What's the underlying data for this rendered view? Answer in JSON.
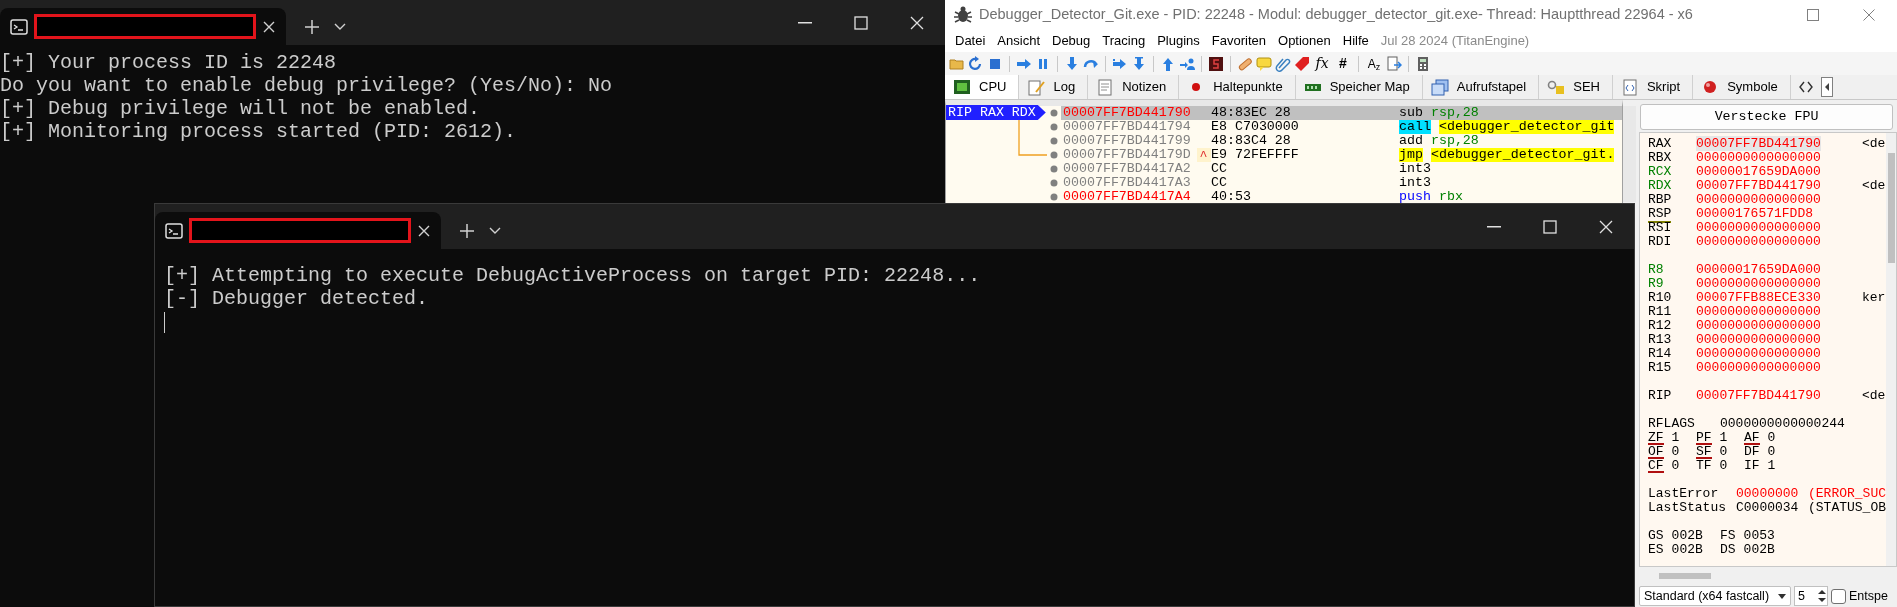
{
  "back_terminal": {
    "lines": [
      "[+] Your process ID is 22248",
      "Do you want to enable debug privilege? (Yes/No): No",
      "[+] Debug privilege will not be enabled.",
      "[+] Monitoring process started (PID: 2612)."
    ]
  },
  "debugger": {
    "title": "Debugger_Detector_Git.exe - PID: 22248 - Modul: debugger_detector_git.exe- Thread: Hauptthread 22964 - x6",
    "menu": [
      "Datei",
      "Ansicht",
      "Debug",
      "Tracing",
      "Plugins",
      "Favoriten",
      "Optionen",
      "Hilfe"
    ],
    "build_info": "Jul 28 2024 (TitanEngine)",
    "toolbar_glyphs": [
      "fx",
      "#",
      "A$_{z}$"
    ],
    "tabs": [
      {
        "label": "CPU",
        "selected": true
      },
      {
        "label": "Log",
        "selected": false
      },
      {
        "label": "Notizen",
        "selected": false
      },
      {
        "label": "Haltepunkte",
        "selected": false
      },
      {
        "label": "Speicher Map",
        "selected": false
      },
      {
        "label": "Aufrufstapel",
        "selected": false
      },
      {
        "label": "SEH",
        "selected": false
      },
      {
        "label": "Skript",
        "selected": false
      },
      {
        "label": "Symbole",
        "selected": false
      }
    ],
    "disassembly": {
      "rip_label": "RIP RAX RDX",
      "rows": [
        {
          "address": "00007FF7BD441790",
          "color": "#ff0000",
          "bytes": "48:83EC 28",
          "kind": "plain",
          "mnemonic": "sub",
          "operands": "rsp,28",
          "selected": true
        },
        {
          "address": "00007FF7BD441794",
          "color": "#808080",
          "bytes": "E8 C7030000",
          "kind": "call",
          "mnemonic": "call",
          "operands": "<debugger_detector_git",
          "selected": false
        },
        {
          "address": "00007FF7BD441799",
          "color": "#808080",
          "bytes": "48:83C4 28",
          "kind": "plain",
          "mnemonic": "add",
          "operands": "rsp,28",
          "selected": false
        },
        {
          "address": "00007FF7BD44179D",
          "color": "#808080",
          "bytes": "E9 72FEFFFF",
          "marker": "^",
          "kind": "jmp",
          "mnemonic": "jmp",
          "operands": "<debugger_detector_git.",
          "selected": false
        },
        {
          "address": "00007FF7BD4417A2",
          "color": "#808080",
          "bytes": "CC",
          "kind": "plain",
          "mnemonic": "int3",
          "selected": false
        },
        {
          "address": "00007FF7BD4417A3",
          "color": "#808080",
          "bytes": "CC",
          "kind": "plain",
          "mnemonic": "int3",
          "selected": false
        },
        {
          "address": "00007FF7BD4417A4",
          "color": "#ff0000",
          "bytes": "40:53",
          "kind": "push",
          "mnemonic": "push",
          "operands": "rbx",
          "selected": false
        }
      ]
    },
    "registers": {
      "fpu_button": "Verstecke FPU",
      "groups": [
        [
          {
            "name": "RAX",
            "color": "#000000",
            "value": "00007FF7BD441790",
            "changed": true,
            "selected": true,
            "underlined": false,
            "comment": "<de"
          },
          {
            "name": "RBX",
            "color": "#000000",
            "value": "0000000000000000",
            "changed": true,
            "selected": false,
            "underlined": false
          },
          {
            "name": "RCX",
            "color": "#008000",
            "value": "00000017659DA000",
            "changed": true,
            "selected": false,
            "underlined": false
          },
          {
            "name": "RDX",
            "color": "#008000",
            "value": "00007FF7BD441790",
            "changed": true,
            "selected": false,
            "underlined": false,
            "comment": "<de"
          },
          {
            "name": "RBP",
            "color": "#000000",
            "value": "0000000000000000",
            "changed": true,
            "selected": false,
            "underlined": false
          },
          {
            "name": "RSP",
            "color": "#000000",
            "value": "00000176571FDD8",
            "changed": true,
            "selected": false,
            "underlined": true
          },
          {
            "name": "RSI",
            "color": "#000000",
            "value": "0000000000000000",
            "changed": true,
            "selected": false,
            "underlined": false
          },
          {
            "name": "RDI",
            "color": "#000000",
            "value": "0000000000000000",
            "changed": true,
            "selected": false,
            "underlined": false
          }
        ],
        [
          {
            "name": "R8",
            "color": "#008000",
            "value": "00000017659DA000",
            "changed": true,
            "selected": false,
            "underlined": false
          },
          {
            "name": "R9",
            "color": "#008000",
            "value": "0000000000000000",
            "changed": true,
            "selected": false,
            "underlined": false
          },
          {
            "name": "R10",
            "color": "#000000",
            "value": "00007FFB88ECE330",
            "changed": true,
            "selected": false,
            "underlined": false,
            "comment": "ker"
          },
          {
            "name": "R11",
            "color": "#000000",
            "value": "0000000000000000",
            "changed": true,
            "selected": false,
            "underlined": false
          },
          {
            "name": "R12",
            "color": "#000000",
            "value": "0000000000000000",
            "changed": true,
            "selected": false,
            "underlined": false
          },
          {
            "name": "R13",
            "color": "#000000",
            "value": "0000000000000000",
            "changed": true,
            "selected": false,
            "underlined": false
          },
          {
            "name": "R14",
            "color": "#000000",
            "value": "0000000000000000",
            "changed": true,
            "selected": false,
            "underlined": false
          },
          {
            "name": "R15",
            "color": "#000000",
            "value": "0000000000000000",
            "changed": true,
            "selected": false,
            "underlined": false
          }
        ],
        [
          {
            "name": "RIP",
            "color": "#000000",
            "value": "00007FF7BD441790",
            "changed": true,
            "selected": false,
            "underlined": false,
            "comment": "<de"
          }
        ]
      ],
      "rflags": {
        "name": "RFLAGS",
        "value": "0000000000000244"
      },
      "flags": [
        [
          {
            "name": "ZF",
            "value": "1",
            "underlined": true
          },
          {
            "name": "PF",
            "value": "1",
            "underlined": true
          },
          {
            "name": "AF",
            "value": "0",
            "underlined": true
          }
        ],
        [
          {
            "name": "OF",
            "value": "0",
            "underlined": true
          },
          {
            "name": "SF",
            "value": "0",
            "underlined": true
          },
          {
            "name": "DF",
            "value": "0",
            "underlined": false
          }
        ],
        [
          {
            "name": "CF",
            "value": "0",
            "underlined": true
          },
          {
            "name": "TF",
            "value": "0",
            "underlined": false
          },
          {
            "name": "IF",
            "value": "1",
            "underlined": false
          }
        ]
      ],
      "status": [
        {
          "label": "LastError",
          "value": "00000000",
          "text": "(ERROR_SUC",
          "changed": true
        },
        {
          "label": "LastStatus",
          "value": "C0000034",
          "text": "(STATUS_OB",
          "changed": false
        }
      ],
      "segments": [
        [
          {
            "name": "GS",
            "value": "002B"
          },
          {
            "name": "FS",
            "value": "0053"
          }
        ],
        [
          {
            "name": "ES",
            "value": "002B"
          },
          {
            "name": "DS",
            "value": "002B"
          }
        ]
      ]
    },
    "call_convention": "Standard (x64 fastcall)",
    "arg_count": "5",
    "checkbox": {
      "label": "Entspe",
      "checked": false
    }
  },
  "front_terminal": {
    "lines": [
      "[+] Attempting to execute DebugActiveProcess on target PID: 22248...",
      "[-] Debugger detected."
    ]
  }
}
